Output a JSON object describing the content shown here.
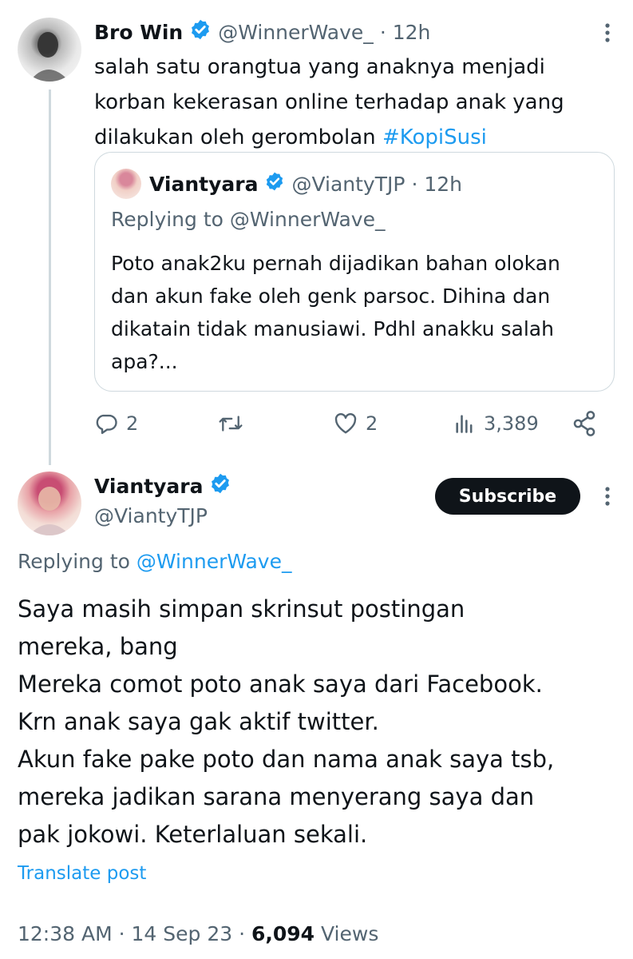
{
  "parent_tweet": {
    "name": "Bro Win",
    "handle": "@WinnerWave_",
    "time": "· 12h",
    "text_plain": "salah satu orangtua yang anaknya menjadi korban kekerasan online terhadap anak yang dilakukan oleh gerombolan ",
    "hashtag": "#KopiSusi",
    "quote": {
      "name": "Viantyara",
      "handle": "@ViantyTJP",
      "time": "· 12h",
      "replying_prefix": "Replying to ",
      "replying_handle": "@WinnerWave_",
      "text": "Poto anak2ku pernah dijadikan bahan olokan dan akun fake oleh genk parsoc. Dihina dan dikatain  tidak manusiawi. Pdhl anakku salah apa?..."
    },
    "actions": {
      "replies": "2",
      "likes": "2",
      "views": "3,389"
    }
  },
  "main_tweet": {
    "name": "Viantyara",
    "handle": "@ViantyTJP",
    "subscribe_label": "Subscribe",
    "replying_prefix": "Replying to ",
    "replying_handle": "@WinnerWave_",
    "lines": [
      "Saya masih simpan skrinsut postingan",
      "mereka, bang",
      "Mereka comot poto anak saya dari Facebook.",
      "Krn anak saya gak aktif twitter.",
      "Akun fake pake poto dan nama anak saya tsb,",
      "mereka jadikan sarana menyerang saya dan",
      "pak jokowi. Keterlaluan sekali."
    ],
    "translate_label": "Translate post",
    "meta_time": "12:38 AM · 14 Sep 23 · ",
    "meta_views_count": "6,094",
    "meta_views_label": " Views"
  },
  "colors": {
    "accent": "#1d9bf0",
    "muted": "#536471",
    "text": "#0f1419",
    "border": "#cfd9de"
  }
}
